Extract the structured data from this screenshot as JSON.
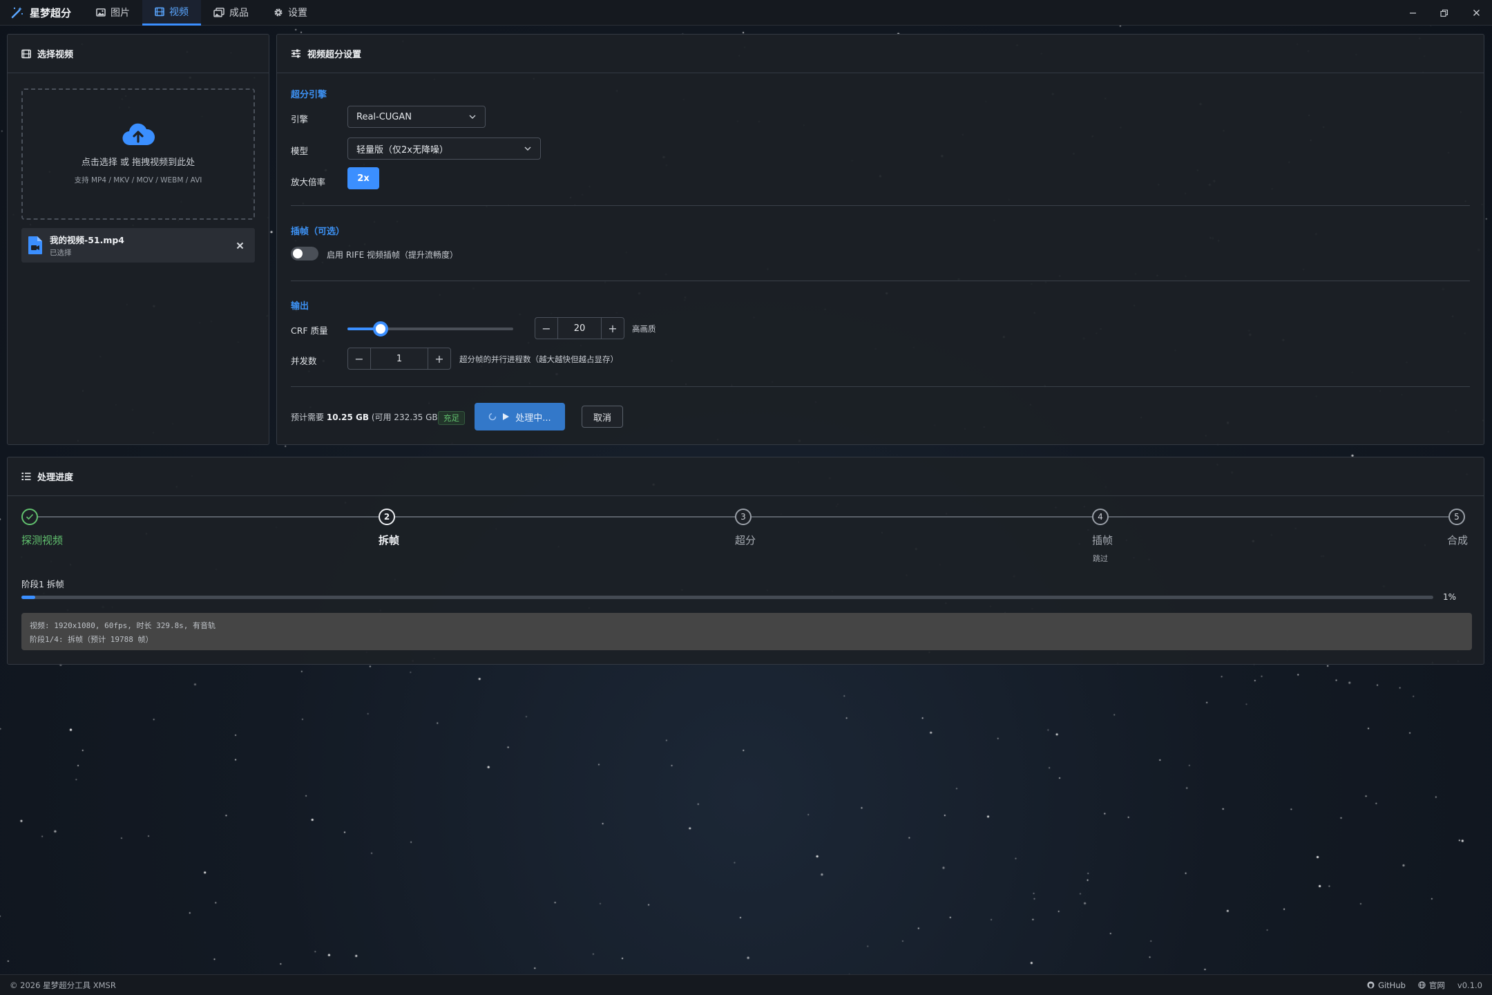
{
  "titlebar": {
    "brand": "星梦超分",
    "tabs": [
      {
        "label": "图片",
        "icon": "image-icon"
      },
      {
        "label": "视频",
        "icon": "film-icon",
        "active": true
      },
      {
        "label": "成品",
        "icon": "gallery-icon"
      },
      {
        "label": "设置",
        "icon": "gear-icon"
      }
    ]
  },
  "left_panel": {
    "title": "选择视频",
    "dropzone": {
      "main_text": "点击选择 或 拖拽视频到此处",
      "formats": "支持 MP4 / MKV / MOV / WEBM / AVI"
    },
    "file": {
      "name": "我的视频-51.mp4",
      "status": "已选择"
    }
  },
  "settings_panel": {
    "title": "视频超分设置",
    "engine_section": "超分引擎",
    "engine_label": "引擎",
    "engine_value": "Real-CUGAN",
    "model_label": "模型",
    "model_value": "轻量版（仅2x无降噪）",
    "scale_label": "放大倍率",
    "scale_value": "2x",
    "interp_section": "插帧（可选）",
    "interp_toggle_label": "启用 RIFE 视频插帧（提升流畅度）",
    "interp_enabled": false,
    "output_section": "输出",
    "crf_label": "CRF 质量",
    "crf_value": "20",
    "crf_slider": {
      "min": 0,
      "max": 100,
      "value": 20
    },
    "crf_hint": "高画质",
    "concurrency_label": "并发数",
    "concurrency_value": "1",
    "concurrency_hint": "超分帧的并行进程数（越大越快但越占显存）",
    "estimate_prefix": "预计需要",
    "estimate_size": "10.25 GB",
    "available": "(可用 232.35 GB)",
    "space_badge": "充足",
    "process_button": "处理中...",
    "cancel_button": "取消"
  },
  "progress_panel": {
    "title": "处理进度",
    "steps": [
      {
        "num": "1",
        "label": "探测视频",
        "state": "done",
        "sub": ""
      },
      {
        "num": "2",
        "label": "拆帧",
        "state": "active",
        "sub": ""
      },
      {
        "num": "3",
        "label": "超分",
        "state": "pending",
        "sub": ""
      },
      {
        "num": "4",
        "label": "插帧",
        "state": "pending",
        "sub": "跳过"
      },
      {
        "num": "5",
        "label": "合成",
        "state": "pending",
        "sub": ""
      }
    ],
    "stage_label": "阶段1 拆帧",
    "progress_percent": 1,
    "progress_text": "1%",
    "log_lines": [
      "视频: 1920x1080, 60fps, 时长 329.8s, 有音轨",
      "阶段1/4: 拆帧（预计 19788 帧）"
    ]
  },
  "footer": {
    "copyright": "© 2026 星梦超分工具 XMSR",
    "github": "GitHub",
    "website": "官网",
    "version": "v0.1.0"
  },
  "colors": {
    "accent": "#3b8fff",
    "success": "#62c26f",
    "panel": "#1c2026",
    "background": "#131a24"
  }
}
